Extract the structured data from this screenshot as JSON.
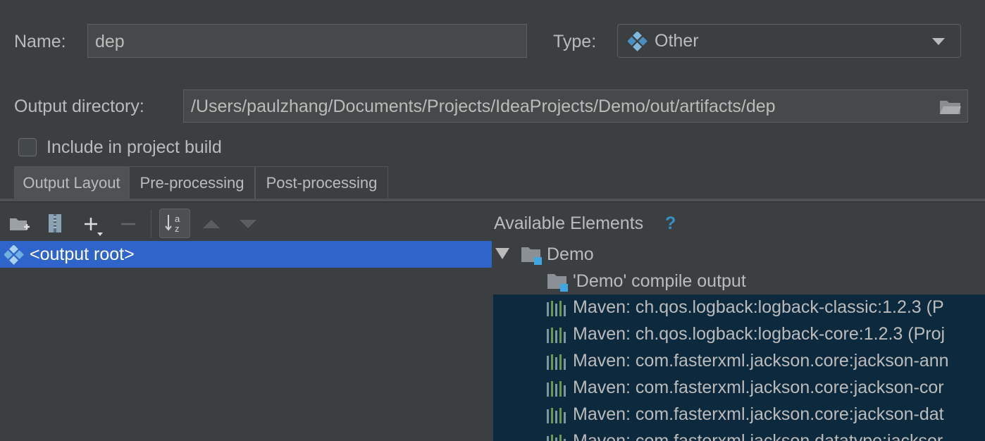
{
  "form": {
    "name_label": "Name:",
    "name_value": "dep",
    "type_label": "Type:",
    "type_value": "Other",
    "output_dir_label": "Output directory:",
    "output_dir_value": "/Users/paulzhang/Documents/Projects/IdeaProjects/Demo/out/artifacts/dep",
    "include_label": "Include in project build",
    "include_checked": false
  },
  "tabs": [
    {
      "label": "Output Layout",
      "active": true
    },
    {
      "label": "Pre-processing",
      "active": false
    },
    {
      "label": "Post-processing",
      "active": false
    }
  ],
  "layout_tree": {
    "root_label": "<output root>"
  },
  "available": {
    "header": "Available Elements",
    "help": "?",
    "module": "Demo",
    "compile_output": "'Demo' compile output",
    "libraries": [
      "Maven: ch.qos.logback:logback-classic:1.2.3 (P",
      "Maven: ch.qos.logback:logback-core:1.2.3 (Proj",
      "Maven: com.fasterxml.jackson.core:jackson-ann",
      "Maven: com.fasterxml.jackson.core:jackson-cor",
      "Maven: com.fasterxml.jackson.core:jackson-dat",
      "Maven: com.fasterxml.jackson.datatype:jacksor"
    ]
  },
  "colors": {
    "background": "#3c3f41",
    "selection": "#2f65ca",
    "library_selection": "#0d293e",
    "accent": "#3592c4"
  }
}
